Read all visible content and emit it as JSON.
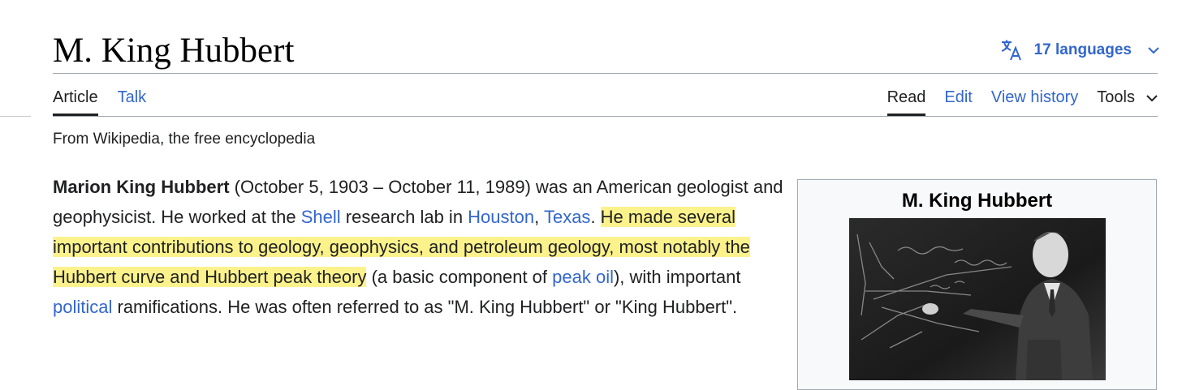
{
  "page": {
    "title": "M. King Hubbert",
    "languages_label": "17 languages",
    "tagline": "From Wikipedia, the free encyclopedia"
  },
  "tabs_left": [
    {
      "label": "Article",
      "selected": true
    },
    {
      "label": "Talk",
      "selected": false
    }
  ],
  "tabs_right": [
    {
      "label": "Read",
      "selected": true
    },
    {
      "label": "Edit",
      "selected": false
    },
    {
      "label": "View history",
      "selected": false
    },
    {
      "label": "Tools",
      "selected": false
    }
  ],
  "intro": {
    "subject": "Marion King Hubbert",
    "t1": " (October 5, 1903 – October 11, 1989) was an American geologist and geophysicist. He worked at the ",
    "link_shell": "Shell",
    "t2": " research lab in ",
    "link_houston": "Houston",
    "t3": ", ",
    "link_texas": "Texas",
    "t4": ". ",
    "highlight": "He made several important contributions to geology, geophysics, and petroleum geology, most notably the Hubbert curve and Hubbert peak theory",
    "t5": " (a basic component of ",
    "link_peak_oil": "peak oil",
    "t6": "), with important ",
    "link_political": "political",
    "t7": " ramifications. He was often referred to as \"M. King Hubbert\" or \"King Hubbert\"."
  },
  "infobox": {
    "title": "M. King Hubbert"
  },
  "icons": {
    "translate": "translate-icon",
    "chevron": "chevron-down-icon"
  },
  "colors": {
    "link": "#3366cc",
    "highlight": "#fcf28c",
    "text": "#202122",
    "rule": "#a2a9b1"
  }
}
